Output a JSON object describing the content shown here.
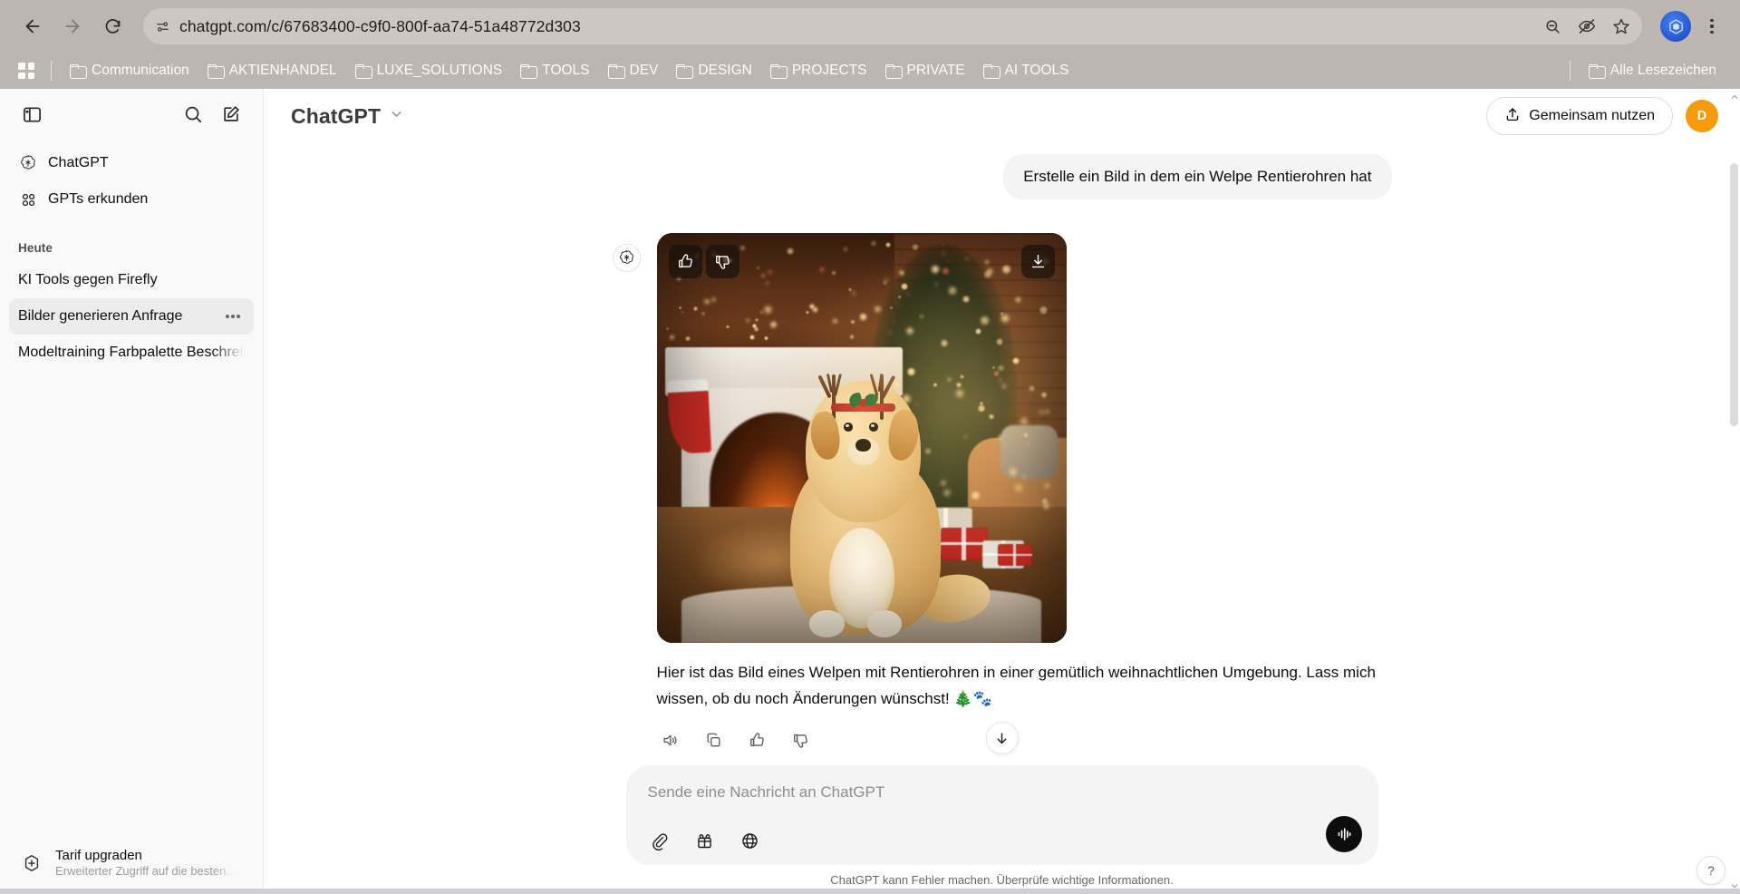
{
  "browser": {
    "url": "chatgpt.com/c/67683400-c9f0-800f-aa74-51a48772d303",
    "back_label": "Zurück",
    "forward_label": "Vorwärts",
    "reload_label": "Neu laden",
    "site_info_label": "Website-Informationen",
    "zoom_label": "Zoom",
    "tracking_label": "Tracking-Schutz",
    "bookmark_label": "Lesezeichen hinzufügen",
    "profile_label": "Profil",
    "menu_label": "Chrome anpassen und einstellen",
    "apps_label": "Apps",
    "bookmarks": [
      {
        "label": "Communication"
      },
      {
        "label": "AKTIENHANDEL"
      },
      {
        "label": "LUXE_SOLUTIONS"
      },
      {
        "label": "TOOLS"
      },
      {
        "label": "DEV"
      },
      {
        "label": "DESIGN"
      },
      {
        "label": "PROJECTS"
      },
      {
        "label": "PRIVATE"
      },
      {
        "label": "AI TOOLS"
      }
    ],
    "all_bookmarks": "Alle Lesezeichen"
  },
  "sidebar": {
    "toggle_label": "Seitenleiste schließen",
    "search_label": "Chats durchsuchen",
    "new_chat_label": "Neuer Chat",
    "nav": [
      {
        "label": "ChatGPT",
        "icon": "openai-icon"
      },
      {
        "label": "GPTs erkunden",
        "icon": "grid-icon"
      }
    ],
    "section_label": "Heute",
    "chats": [
      {
        "label": "KI Tools gegen Firefly",
        "active": false
      },
      {
        "label": "Bilder generieren Anfrage",
        "active": true
      },
      {
        "label": "Modeltraining Farbpalette Beschreibung",
        "active": false
      }
    ],
    "upgrade": {
      "title": "Tarif upgraden",
      "subtitle": "Erweiterter Zugriff auf die besten..."
    }
  },
  "header": {
    "model": "ChatGPT",
    "share_label": "Gemeinsam nutzen",
    "avatar_initial": "D"
  },
  "conversation": {
    "user_message": "Erstelle ein Bild in dem ein Welpe Rentierohren hat",
    "assistant_message": "Hier ist das Bild eines Welpen mit Rentierohren in einer gemütlich weihnachtlichen Umgebung. Lass mich wissen, ob du noch Änderungen wünschst! 🎄🐾",
    "image": {
      "alt": "Golden-Retriever-Welpe mit Rentiergeweih-Haarreif vor einem Kamin mit Weihnachtsbaum",
      "like_label": "Gefällt mir",
      "dislike_label": "Gefällt mir nicht",
      "download_label": "Herunterladen"
    },
    "actions": [
      {
        "name": "read-aloud-button",
        "label": "Vorlesen"
      },
      {
        "name": "copy-button",
        "label": "Kopieren"
      },
      {
        "name": "like-button",
        "label": "Gefällt mir"
      },
      {
        "name": "dislike-button",
        "label": "Gefällt mir nicht"
      }
    ],
    "scroll_down_label": "Nach unten scrollen"
  },
  "composer": {
    "placeholder": "Sende eine Nachricht an ChatGPT",
    "attach_label": "Datei anhängen",
    "tools_label": "Tools",
    "search_web_label": "Im Web suchen",
    "voice_label": "Sprachmodus verwenden",
    "disclaimer": "ChatGPT kann Fehler machen. Überprüfe wichtige Informationen."
  },
  "misc": {
    "help_label": "?"
  },
  "colors": {
    "browser_chrome": "#bdb5b2",
    "sidebar_bg": "#f9f9f9",
    "accent_avatar": "#f59b0b",
    "user_bubble": "#f4f4f4",
    "composer_bg": "#f4f4f4"
  }
}
